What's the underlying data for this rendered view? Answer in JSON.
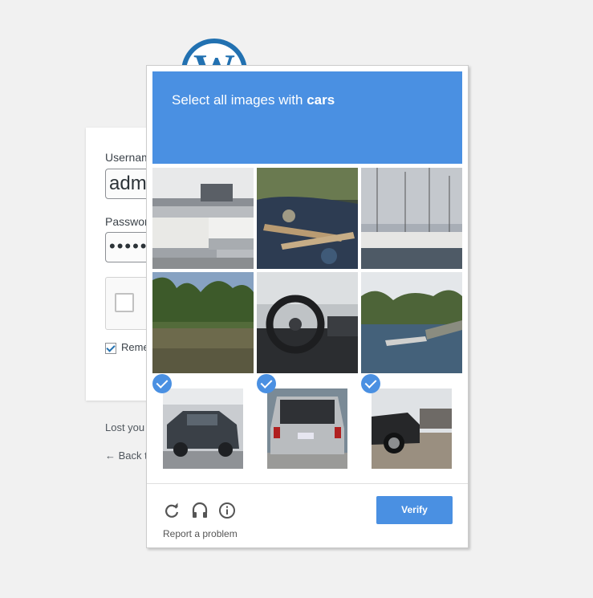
{
  "login": {
    "logo_letter": "W",
    "username_label": "Usernam",
    "username_value": "adm",
    "password_label": "Passwor",
    "password_value": "•••••",
    "remember_label": "Reme",
    "lost_password": "Lost you",
    "back_link": "← Back t"
  },
  "challenge": {
    "title_prefix": "Select all images with ",
    "title_target": "cars",
    "tiles": [
      {
        "subject": "hotel-room-beds",
        "selected": false
      },
      {
        "subject": "stream-with-logs",
        "selected": false
      },
      {
        "subject": "marina-sailboats",
        "selected": false
      },
      {
        "subject": "river-with-trees",
        "selected": false
      },
      {
        "subject": "car-interior-steering-wheel",
        "selected": false
      },
      {
        "subject": "lake-dock",
        "selected": false
      },
      {
        "subject": "dark-sedan-car",
        "selected": true
      },
      {
        "subject": "silver-minivan-rear",
        "selected": true
      },
      {
        "subject": "black-muscle-car",
        "selected": true
      }
    ],
    "icons": [
      "reload-icon",
      "headphones-icon",
      "info-icon"
    ],
    "report_label": "Report a problem",
    "verify_label": "Verify"
  },
  "colors": {
    "accent": "#4a90e2",
    "wp_blue": "#2271b1",
    "background": "#f1f1f1"
  }
}
